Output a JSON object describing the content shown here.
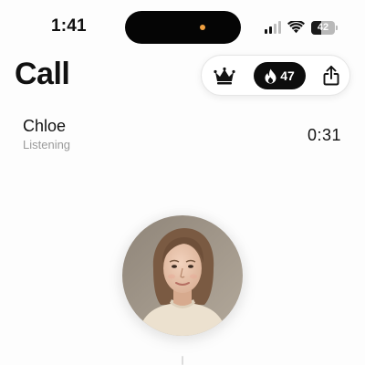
{
  "status_bar": {
    "time": "1:41",
    "battery_level": 42,
    "battery_text": "42",
    "signal_icon": "cellular-signal-icon",
    "wifi_icon": "wifi-icon",
    "indicator_color": "#f0a040"
  },
  "header": {
    "title": "Call",
    "crown_icon": "crown-icon",
    "streak_icon": "flame-icon",
    "streak_count": "47",
    "share_icon": "share-icon"
  },
  "call": {
    "caller_name": "Chloe",
    "status": "Listening",
    "timer": "0:31"
  },
  "avatar": {
    "icon": "avatar-photo"
  }
}
